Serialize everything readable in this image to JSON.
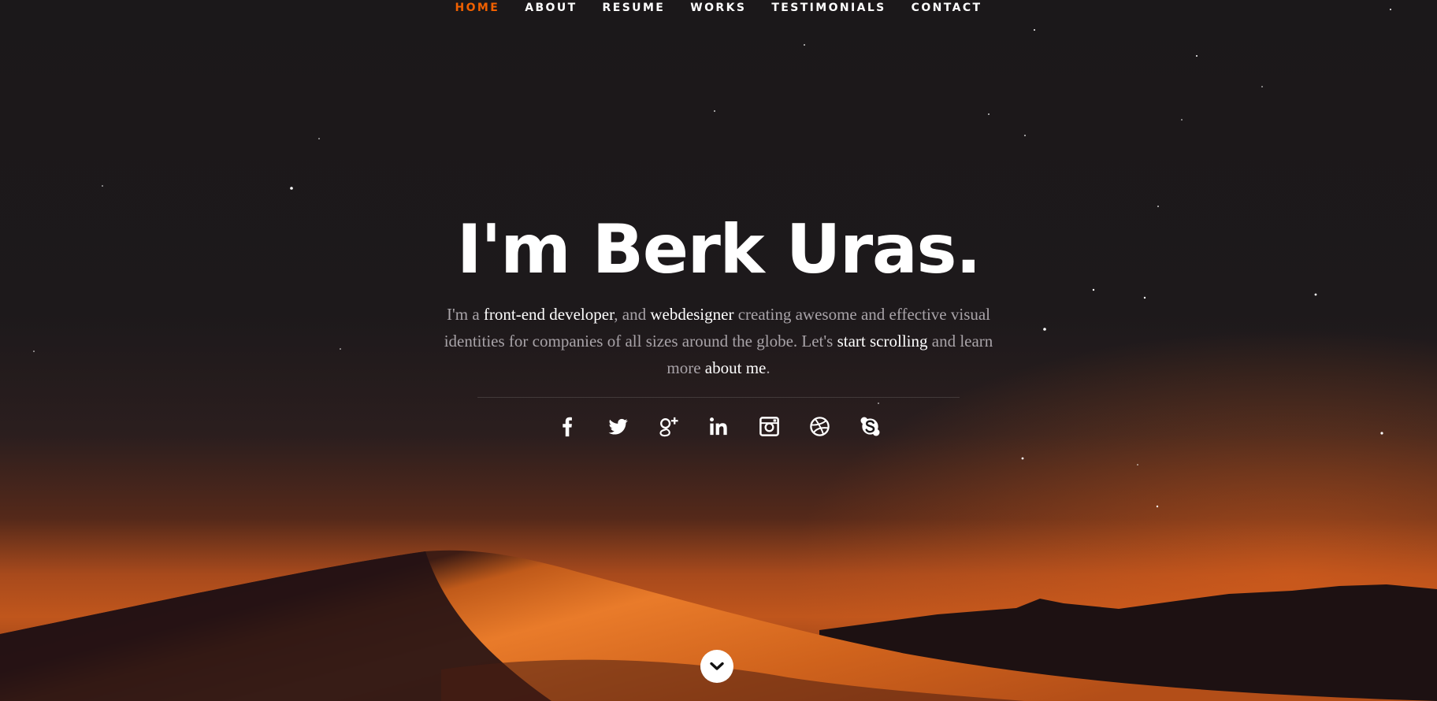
{
  "nav": {
    "items": [
      {
        "label": "HOME",
        "active": true
      },
      {
        "label": "ABOUT",
        "active": false
      },
      {
        "label": "RESUME",
        "active": false
      },
      {
        "label": "WORKS",
        "active": false
      },
      {
        "label": "TESTIMONIALS",
        "active": false
      },
      {
        "label": "CONTACT",
        "active": false
      }
    ],
    "active_color": "#f06000"
  },
  "hero": {
    "title": "I'm Berk Uras.",
    "intro": {
      "t1": "I'm a ",
      "h1": "front-end developer",
      "t2": ", and ",
      "h2": "webdesigner",
      "t3": " creating awesome and effective visual identities for companies of all sizes around the globe. Let's ",
      "h3": "start scrolling",
      "t4": " and learn more ",
      "h4": "about me",
      "t5": "."
    }
  },
  "social": [
    {
      "icon": "facebook-icon"
    },
    {
      "icon": "twitter-icon"
    },
    {
      "icon": "google-plus-icon"
    },
    {
      "icon": "linkedin-icon"
    },
    {
      "icon": "instagram-icon"
    },
    {
      "icon": "dribbble-icon"
    },
    {
      "icon": "skype-icon"
    }
  ],
  "scroll_button": {
    "icon": "chevron-down-icon"
  },
  "colors": {
    "background": "#1b181a",
    "dune_glow": "#e86a1c",
    "muted_text": "#a8a3a8"
  }
}
